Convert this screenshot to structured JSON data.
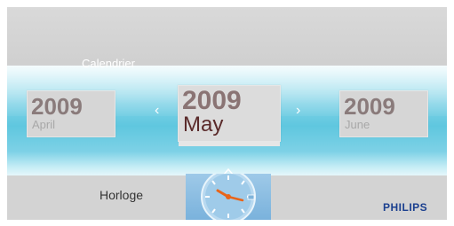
{
  "calendar": {
    "section_title": "Calendrier",
    "prev": {
      "year": "2009",
      "month": "April"
    },
    "current": {
      "year": "2009",
      "month": "May"
    },
    "next": {
      "year": "2009",
      "month": "June"
    },
    "nav_prev": "‹",
    "nav_next": "›"
  },
  "bottom": {
    "label": "Horloge",
    "clock_icon": "clock-icon"
  },
  "brand": {
    "name": "PHILIPS",
    "color": "#1a3f8f"
  },
  "colors": {
    "accent": "#5fc7df",
    "background": "#d3d3d3"
  }
}
